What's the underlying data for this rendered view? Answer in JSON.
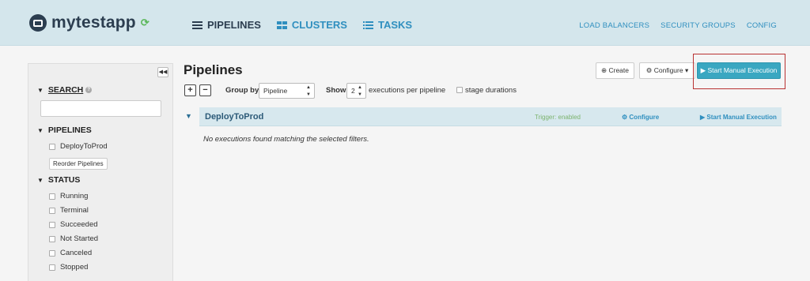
{
  "app": {
    "name": "mytestapp"
  },
  "nav": {
    "pipelines": "PIPELINES",
    "clusters": "CLUSTERS",
    "tasks": "TASKS"
  },
  "topright": {
    "load_balancers": "LOAD BALANCERS",
    "security_groups": "SECURITY GROUPS",
    "config": "CONFIG"
  },
  "sidebar": {
    "search_label": "SEARCH",
    "pipelines_label": "PIPELINES",
    "pipelines": [
      "DeployToProd"
    ],
    "reorder_label": "Reorder Pipelines",
    "status_label": "STATUS",
    "statuses": [
      "Running",
      "Terminal",
      "Succeeded",
      "Not Started",
      "Canceled",
      "Stopped"
    ]
  },
  "main": {
    "title": "Pipelines",
    "group_by_label": "Group by",
    "group_by_value": "Pipeline",
    "show_label": "Show",
    "show_value": "2",
    "executions_label": "executions per pipeline",
    "stage_durations_label": "stage durations",
    "create_label": "Create",
    "configure_label": "Configure",
    "start_label": "Start Manual Execution"
  },
  "pipeline_row": {
    "name": "DeployToProd",
    "trigger": "Trigger: enabled",
    "configure": "Configure",
    "start": "Start Manual Execution"
  },
  "empty_message": "No executions found matching the selected filters.",
  "colors": {
    "header_bg": "#d4e6ec",
    "accent": "#3aa7c1",
    "link": "#2f8fbf",
    "highlight": "#b83232"
  }
}
